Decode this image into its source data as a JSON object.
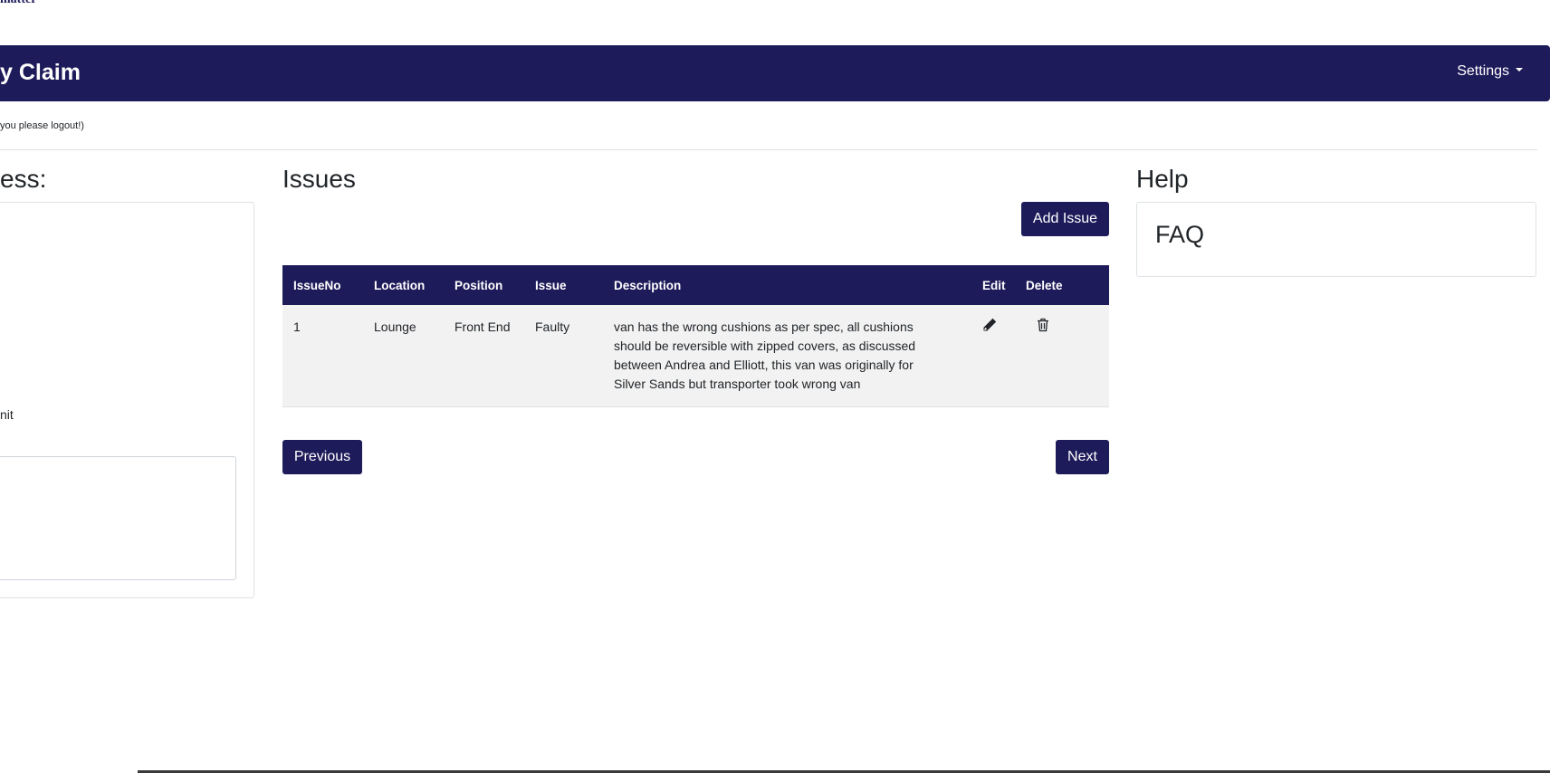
{
  "header": {
    "logo_fragment": "matter",
    "title": "y Claim",
    "settings_label": "Settings"
  },
  "notice": "you please logout!)",
  "left_panel": {
    "heading": "ess:",
    "text_fragment": "nit"
  },
  "issues": {
    "heading": "Issues",
    "add_button": "Add Issue",
    "columns": [
      "IssueNo",
      "Location",
      "Position",
      "Issue",
      "Description",
      "Edit",
      "Delete"
    ],
    "rows": [
      {
        "issue_no": "1",
        "location": "Lounge",
        "position": "Front End",
        "issue": "Faulty",
        "description": "van has the wrong cushions as per spec, all cushions should be reversible with zipped covers, as discussed between Andrea and Elliott, this van was originally for Silver Sands but transporter took wrong van"
      }
    ],
    "previous_button": "Previous",
    "next_button": "Next"
  },
  "help": {
    "heading": "Help",
    "faq_label": "FAQ"
  },
  "colors": {
    "brand": "#1e1b5a",
    "row_background": "#f2f2f2"
  },
  "icons": {
    "edit": "pencil-icon",
    "delete": "trash-icon",
    "settings": "caret-down-icon"
  }
}
